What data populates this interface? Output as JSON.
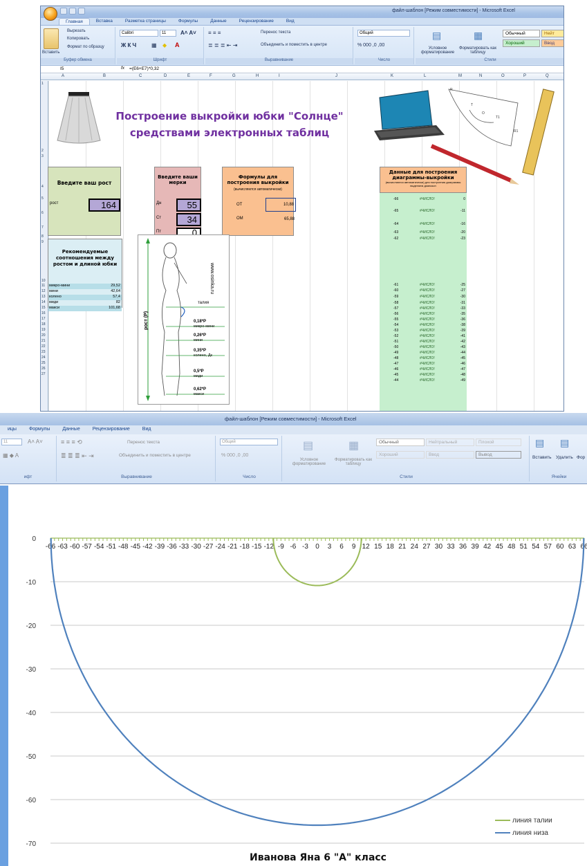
{
  "window1": {
    "title": "файл-шаблон [Режим совместимости] - Microsoft Excel",
    "tabs": [
      "Главная",
      "Вставка",
      "Разметка страницы",
      "Формулы",
      "Данные",
      "Рецензирование",
      "Вид"
    ],
    "clipboard": {
      "paste": "Вставить",
      "cut": "Вырезать",
      "copy": "Копировать",
      "format_painter": "Формат по образцу",
      "label": "Буфер обмена"
    },
    "font": {
      "name": "Calibri",
      "size": "11",
      "label": "Шрифт"
    },
    "alignment": {
      "wrap": "Перенос текста",
      "merge": "Объединить и поместить в центре",
      "label": "Выравнивание"
    },
    "number": {
      "format": "Общий",
      "label": "Число"
    },
    "styles": {
      "conditional": "Условное форматирование",
      "table": "Форматировать как таблицу",
      "normal": "Обычный",
      "neutral": "Нейт",
      "good": "Хороший",
      "input": "Ввод",
      "label": "Стили"
    },
    "formula_bar": {
      "cell_ref": "I5",
      "fx": "fx",
      "formula": "=(E6+E7)*0,32"
    },
    "columns": [
      "A",
      "B",
      "C",
      "D",
      "E",
      "F",
      "G",
      "H",
      "I",
      "J",
      "K",
      "L",
      "M",
      "N",
      "O",
      "P",
      "Q"
    ],
    "rows": [
      "1",
      "2",
      "3",
      "4",
      "5",
      "6",
      "7",
      "8",
      "9",
      "10",
      "11",
      "12",
      "13",
      "14",
      "15",
      "16",
      "17",
      "18",
      "19",
      "20",
      "21",
      "22",
      "23",
      "24",
      "25",
      "26",
      "27"
    ],
    "heading": {
      "line1": "Построение выкройки юбки \"Солнце\"",
      "line2": "средствами электронных таблиц"
    },
    "height_box": {
      "title": "Введите ваш рост",
      "label": "рост",
      "value": "164"
    },
    "measures_box": {
      "title": "Введите ваши мерки",
      "labels": [
        "Дн",
        "Ст",
        "Пт"
      ],
      "values": [
        "55",
        "34",
        "0"
      ]
    },
    "formulas_box": {
      "title": "Формулы для построения выкройки",
      "subtitle": "(вычисляются автоматически)",
      "labels": [
        "ОТ",
        "ОМ"
      ],
      "values": [
        "10,88",
        "65,88"
      ]
    },
    "data_box": {
      "title": "Данные для построения диаграммы-выкройки",
      "subtitle": "(вычисляются автоматически) для построения диаграммы выделяем диапазон"
    },
    "data_rows": [
      [
        "-66",
        "#ЧИСЛО!",
        "0"
      ],
      [
        "-65",
        "#ЧИСЛО!",
        "-11"
      ],
      [
        "-64",
        "#ЧИСЛО!",
        "-16"
      ],
      [
        "-63",
        "#ЧИСЛО!",
        "-20"
      ],
      [
        "-62",
        "#ЧИСЛО!",
        "-23"
      ],
      [
        "-61",
        "#ЧИСЛО!",
        "-25"
      ],
      [
        "-60",
        "#ЧИСЛО!",
        "-27"
      ],
      [
        "-59",
        "#ЧИСЛО!",
        "-30"
      ],
      [
        "-58",
        "#ЧИСЛО!",
        "-31"
      ],
      [
        "-57",
        "#ЧИСЛО!",
        "-33"
      ],
      [
        "-56",
        "#ЧИСЛО!",
        "-35"
      ],
      [
        "-55",
        "#ЧИСЛО!",
        "-36"
      ],
      [
        "-54",
        "#ЧИСЛО!",
        "-38"
      ],
      [
        "-53",
        "#ЧИСЛО!",
        "-39"
      ],
      [
        "-52",
        "#ЧИСЛО!",
        "-41"
      ],
      [
        "-51",
        "#ЧИСЛО!",
        "-42"
      ],
      [
        "-50",
        "#ЧИСЛО!",
        "-43"
      ],
      [
        "-49",
        "#ЧИСЛО!",
        "-44"
      ],
      [
        "-48",
        "#ЧИСЛО!",
        "-45"
      ],
      [
        "-47",
        "#ЧИСЛО!",
        "-46"
      ],
      [
        "-46",
        "#ЧИСЛО!",
        "-47"
      ],
      [
        "-45",
        "#ЧИСЛО!",
        "-48"
      ],
      [
        "-44",
        "#ЧИСЛО!",
        "-49"
      ]
    ],
    "recommend_box": {
      "title": "Рекомендуемые соотношения между ростом и длиной юбки",
      "rows": [
        [
          "микро-мини",
          "29,52"
        ],
        [
          "мини",
          "42,64"
        ],
        [
          "колено",
          "57,4"
        ],
        [
          "миди",
          "82"
        ],
        [
          "макси",
          "101,68"
        ]
      ]
    },
    "figure": {
      "site": "www.osinka.ru",
      "height_label": "рост (Р)",
      "waist": "талия",
      "marks": [
        [
          "0,18*Р",
          "микро-мини"
        ],
        [
          "0,26*Р",
          "мини"
        ],
        [
          "0,35*Р",
          "колено, Дк"
        ],
        [
          "0,5*Р",
          "миди"
        ],
        [
          "0,62*Р",
          "макси"
        ]
      ]
    },
    "pattern_letters": [
      "R",
      "O",
      "T",
      "T1",
      "R1"
    ]
  },
  "window2": {
    "title": "файл-шаблон [Режим совместимости] - Microsoft Excel",
    "tabs": [
      "ицы",
      "Формулы",
      "Данные",
      "Рецензирование",
      "Вид"
    ],
    "font_size": "11",
    "wrap": "Перенос текста",
    "merge": "Объединить и поместить в центре",
    "number_format": "Общий",
    "conditional": "Условное форматирование",
    "table": "Форматировать как таблицу",
    "styles": [
      "Обычный",
      "Нейтральный",
      "Плохой",
      "Хороший",
      "Ввод",
      "Вывод"
    ],
    "cells": [
      "Вставить",
      "Удалить",
      "Фор"
    ],
    "group_labels": [
      "ифт",
      "Выравнивание",
      "Число",
      "Стили",
      "Ячейки"
    ]
  },
  "chart_data": {
    "type": "line",
    "x_tick_labels": [
      "-66",
      "-63",
      "-60",
      "-57",
      "-54",
      "-51",
      "-48",
      "-45",
      "-42",
      "-39",
      "-36",
      "-33",
      "-30",
      "-27",
      "-24",
      "-21",
      "-18",
      "-15",
      "-12",
      "-9",
      "-6",
      "-3",
      "0",
      "3",
      "6",
      "9",
      "12",
      "15",
      "18",
      "21",
      "24",
      "27",
      "30",
      "33",
      "36",
      "39",
      "42",
      "45",
      "48",
      "51",
      "54",
      "57",
      "60",
      "63",
      "66"
    ],
    "y_tick_labels": [
      "0",
      "-10",
      "-20",
      "-30",
      "-40",
      "-50",
      "-60",
      "-70"
    ],
    "xlim": [
      -66,
      66
    ],
    "ylim": [
      -70,
      0
    ],
    "grid": true,
    "legend_position": "bottom-right",
    "series": [
      {
        "name": "линия талии",
        "color": "#9bbb59",
        "radius": 10.88
      },
      {
        "name": "линия низа",
        "color": "#4f81bd",
        "radius": 65.88
      }
    ],
    "caption": "Иванова Яна 6 \"А\" класс"
  }
}
